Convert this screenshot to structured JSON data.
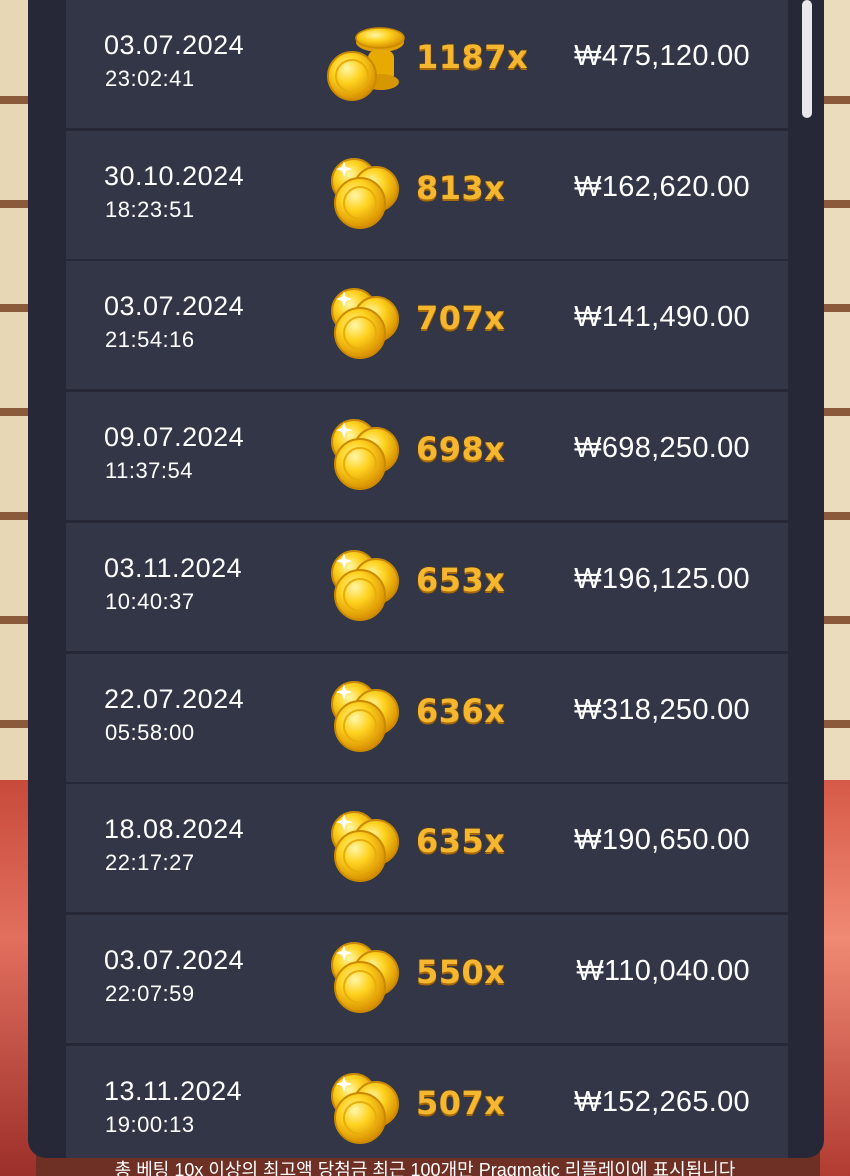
{
  "records": [
    {
      "date": "03.07.2024",
      "time": "23:02:41",
      "multiplier": "1187x",
      "amount": "₩475,120.00",
      "coin": "coin-stack-icon"
    },
    {
      "date": "30.10.2024",
      "time": "18:23:51",
      "multiplier": "813x",
      "amount": "₩162,620.00",
      "coin": "coins-icon"
    },
    {
      "date": "03.07.2024",
      "time": "21:54:16",
      "multiplier": "707x",
      "amount": "₩141,490.00",
      "coin": "coins-icon"
    },
    {
      "date": "09.07.2024",
      "time": "11:37:54",
      "multiplier": "698x",
      "amount": "₩698,250.00",
      "coin": "coins-icon"
    },
    {
      "date": "03.11.2024",
      "time": "10:40:37",
      "multiplier": "653x",
      "amount": "₩196,125.00",
      "coin": "coins-icon"
    },
    {
      "date": "22.07.2024",
      "time": "05:58:00",
      "multiplier": "636x",
      "amount": "₩318,250.00",
      "coin": "coins-icon"
    },
    {
      "date": "18.08.2024",
      "time": "22:17:27",
      "multiplier": "635x",
      "amount": "₩190,650.00",
      "coin": "coins-icon"
    },
    {
      "date": "03.07.2024",
      "time": "22:07:59",
      "multiplier": "550x",
      "amount": "₩110,040.00",
      "coin": "coins-icon"
    },
    {
      "date": "13.11.2024",
      "time": "19:00:13",
      "multiplier": "507x",
      "amount": "₩152,265.00",
      "coin": "coins-icon"
    }
  ],
  "footer_note": "총 베팅 10x 이상의 최고액 당첨금 최근 100개만 Pragmatic 리플레이에 표시됩니다",
  "colors": {
    "panel": "#262837",
    "row": "#333646",
    "multiplier": "#f5b630",
    "text": "#ffffff"
  },
  "scroll": {
    "position_fraction": 0.0
  }
}
